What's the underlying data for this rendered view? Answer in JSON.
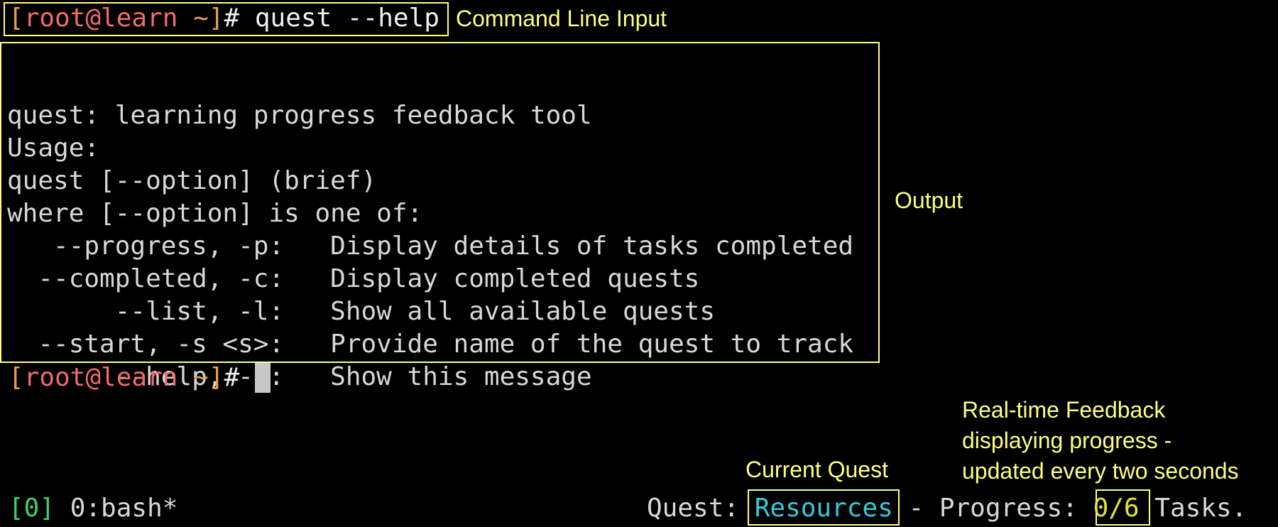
{
  "prompt": {
    "open_bracket": "[",
    "user_host": "root@learn",
    "path": " ~",
    "close_bracket": "]",
    "hash": "#"
  },
  "command": " quest --help",
  "annotations": {
    "command_line_input": "Command Line Input",
    "output": "Output",
    "feedback_line1": "Real-time Feedback",
    "feedback_line2": "displaying progress -",
    "feedback_line3": "updated every two seconds",
    "current_quest": "Current Quest"
  },
  "output": {
    "lines": [
      "quest: learning progress feedback tool",
      "Usage:",
      "quest [--option] (brief)",
      "where [--option] is one of:",
      "   --progress, -p:   Display details of tasks completed",
      "  --completed, -c:   Display completed quests",
      "       --list, -l:   Show all available quests",
      "  --start, -s <s>:   Provide name of the quest to track",
      "       --help, -h:   Show this message"
    ]
  },
  "status_bar": {
    "session": "[0]",
    "window": " 0:bash*",
    "quest_label": "Quest: ",
    "quest_name": "Resources",
    "progress_label": " - Progress: ",
    "progress_value": "0/6",
    "tasks_label": " Tasks."
  },
  "colors": {
    "annotation": "#ffff80",
    "prompt_user": "#ef6b6b",
    "prompt_bracket": "#e7a04a",
    "quest_name": "#37c8d8",
    "progress": "#e5e53b",
    "session": "#3bd16f"
  }
}
